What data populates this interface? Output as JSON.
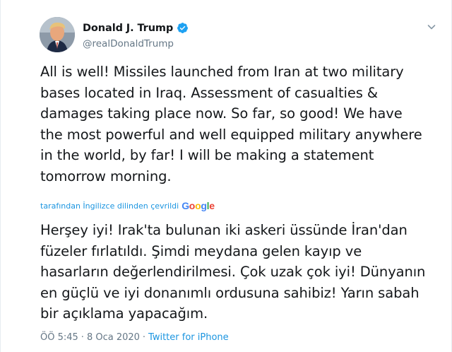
{
  "author": {
    "display_name": "Donald J. Trump",
    "handle": "@realDonaldTrump",
    "verified": true
  },
  "tweet": {
    "text": "All is well! Missiles launched from Iran at two military\nbases located in Iraq. Assessment of casualties &\ndamages taking place now. So far, so good! We have\nthe most powerful and well equipped military anywhere\nin the world, by far! I will be making a statement\ntomorrow morning."
  },
  "translation": {
    "attribution": "tarafından İngilizce dilinden çevrildi",
    "provider": "Google",
    "text": "Herşey iyi! Irak'ta bulunan iki askeri üssünde İran'dan\nfüzeler fırlatıldı. Şimdi meydana gelen kayıp ve\nhasarların değerlendirilmesi. Çok uzak çok iyi! Dünyanın\nen güçlü ve iyi donanımlı ordusuna sahibiz! Yarın sabah\nbir açıklama yapacağım."
  },
  "meta": {
    "time": "ÖÖ 5:45",
    "separator1": "·",
    "date": "8 Oca 2020",
    "separator2": "·",
    "source": "Twitter for iPhone"
  },
  "icons": {
    "verified": "verified-badge-icon",
    "menu": "chevron-down-icon"
  },
  "colors": {
    "accent": "#1da1f2",
    "link": "#1b95e0",
    "text": "#14171a",
    "muted": "#657786"
  }
}
